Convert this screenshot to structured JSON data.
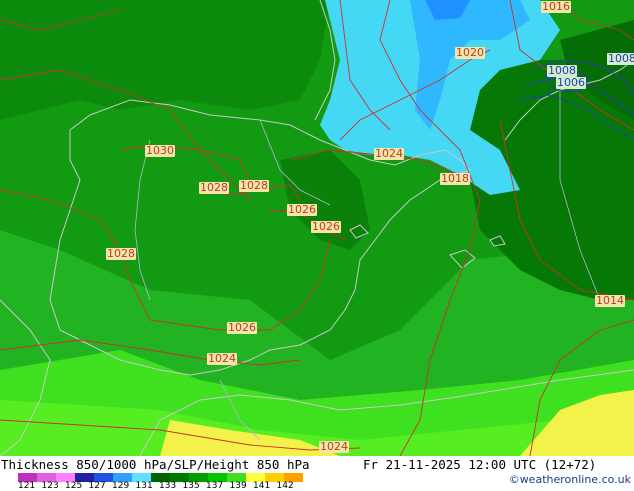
{
  "map": {
    "isobar_labels": [
      {
        "text": "1016",
        "color": "red"
      },
      {
        "text": "1020",
        "color": "red"
      },
      {
        "text": "1008",
        "color": "blue"
      },
      {
        "text": "1006",
        "color": "blue"
      },
      {
        "text": "1008",
        "color": "blue"
      },
      {
        "text": "1030",
        "color": "red"
      },
      {
        "text": "1024",
        "color": "red"
      },
      {
        "text": "1018",
        "color": "red"
      },
      {
        "text": "1028",
        "color": "red"
      },
      {
        "text": "1028",
        "color": "red"
      },
      {
        "text": "1026",
        "color": "red"
      },
      {
        "text": "1026",
        "color": "red"
      },
      {
        "text": "1028",
        "color": "red"
      },
      {
        "text": "1014",
        "color": "red"
      },
      {
        "text": "1026",
        "color": "red"
      },
      {
        "text": "1024",
        "color": "red"
      },
      {
        "text": "1024",
        "color": "red"
      }
    ]
  },
  "footer": {
    "title": "Thickness 850/1000 hPa/SLP/Height 850 hPa",
    "valid_time": "Fr 21-11-2025 12:00 UTC (12+72)",
    "credit": "©weatheronline.co.uk"
  },
  "scale": {
    "ticks": [
      "121",
      "123",
      "125",
      "127",
      "129",
      "131",
      "133",
      "135",
      "137",
      "139",
      "141",
      "142"
    ],
    "colors": [
      "#c030c0",
      "#e060e0",
      "#ff80ff",
      "#2020a0",
      "#2050e0",
      "#30a0ff",
      "#60e0ff",
      "#006400",
      "#007a00",
      "#00a000",
      "#00c800",
      "#40e020",
      "#ffff40",
      "#ffd000",
      "#ffa000"
    ]
  }
}
